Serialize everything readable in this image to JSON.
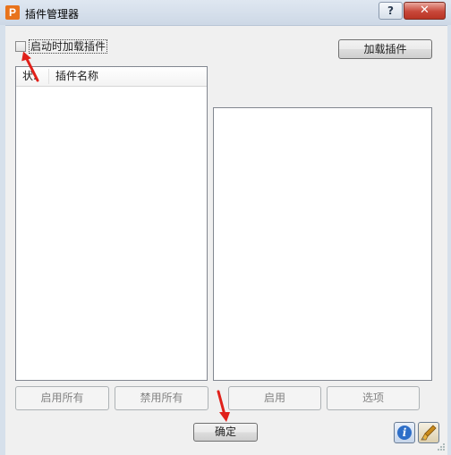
{
  "window": {
    "title": "插件管理器",
    "app_icon": "P",
    "help_glyph": "?",
    "close_glyph": "✕",
    "background_tabs": [
      "",
      "",
      "",
      "",
      "",
      ""
    ]
  },
  "options": {
    "load_on_startup_label": "启动时加载插件",
    "load_on_startup_checked": false,
    "load_plugin_button": "加载插件"
  },
  "plugin_list": {
    "columns": [
      "状.",
      "插件名称"
    ],
    "rows": []
  },
  "actions": {
    "enable_all": "启用所有",
    "disable_all": "禁用所有",
    "enable": "启用",
    "options": "选项",
    "ok": "确定"
  },
  "icons": {
    "info": "info-icon",
    "skin": "skin-brush-icon",
    "arrow_color": "#e0201a"
  }
}
